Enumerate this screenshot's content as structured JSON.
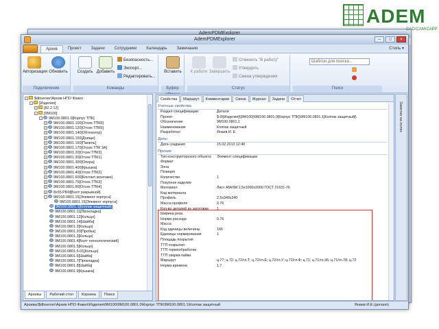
{
  "logo": {
    "text": "ADEM",
    "sub": "CAD/CAM/CAPP"
  },
  "back_window": {
    "title": "AdemPDMExplorer"
  },
  "window": {
    "title": "AdemPDMExplorer"
  },
  "ribbon_tabs": [
    "Архив",
    "Проект",
    "Задачи",
    "Сотрудники",
    "Календарь",
    "Замечания"
  ],
  "style_label": "Стиль ▾",
  "ribbon": {
    "groups": {
      "connect": "Подключение",
      "commands": "Команды",
      "clipboard": "Буфер обмена",
      "status": "Статус",
      "search": "Поиск"
    },
    "buttons": {
      "authorize": "Авторизация",
      "refresh": "Обновить",
      "create": "Создать",
      "add": "Добавить",
      "security": "Безопасность...",
      "export": "Экспорт...",
      "edit": "Редактировать...",
      "paste": "Вставить",
      "to_work": "К работе",
      "finish": "Завершить",
      "cancel_work": "Отменить \"В работу\"",
      "approve": "Утвердить",
      "change_approval": "Смена утверждения"
    },
    "search_placeholder": "Шаблон для поиска..."
  },
  "tree": [
    {
      "lvl": 0,
      "exp": "-",
      "icon": "folder",
      "text": "$dbserver\\Архив НПО Факел"
    },
    {
      "lvl": 1,
      "exp": "-",
      "icon": "folder",
      "text": "[Изделия]"
    },
    {
      "lvl": 2,
      "exp": "+",
      "icon": "folder",
      "text": "[82.2.12]"
    },
    {
      "lvl": 2,
      "exp": "-",
      "icon": "folder",
      "text": "[9M100]"
    },
    {
      "lvl": 3,
      "exp": "-",
      "icon": "gear",
      "text": "9M100.0801.0[Корпус ТПК]"
    },
    {
      "lvl": 4,
      "exp": "+",
      "icon": "gear",
      "text": "9M100.0801.100[Отсек ТПК5]"
    },
    {
      "lvl": 4,
      "exp": "+",
      "icon": "gear",
      "text": "9M100.0801.120[Отсек ТПК5]"
    },
    {
      "lvl": 4,
      "exp": "+",
      "icon": "gear",
      "text": "9M100.0801.140[Обтекатор]"
    },
    {
      "lvl": 4,
      "exp": "+",
      "icon": "gear",
      "text": "9M100.0801.150[Днище]"
    },
    {
      "lvl": 4,
      "exp": "+",
      "icon": "gear",
      "text": "9M100.0801.160[Панель]"
    },
    {
      "lvl": 4,
      "exp": "+",
      "icon": "gear",
      "text": "9M100.0801.170[Отсек ТПК 3А]"
    },
    {
      "lvl": 4,
      "exp": "+",
      "icon": "gear",
      "text": "9M100.0801.20[Отсек ТПК3]"
    },
    {
      "lvl": 4,
      "exp": "+",
      "icon": "gear",
      "text": "9M100.0801.30[Отсек ТПК1]"
    },
    {
      "lvl": 4,
      "exp": "+",
      "icon": "gear",
      "text": "9M100.0801.300[Опора]"
    },
    {
      "lvl": 4,
      "exp": "+",
      "icon": "gear",
      "text": "9M100.0801.400[Крышка]"
    },
    {
      "lvl": 4,
      "exp": "+",
      "icon": "gear",
      "text": "9M100.0801.40[Отсек ТПК2]"
    },
    {
      "lvl": 4,
      "exp": "+",
      "icon": "gear",
      "text": "9M100.0801.600[Контакт монтажн]"
    },
    {
      "lvl": 4,
      "exp": "+",
      "icon": "gear",
      "text": "9M100.0801.70[Отсек ТПК3]"
    },
    {
      "lvl": 4,
      "exp": "+",
      "icon": "gear",
      "text": "9M100.0801.80[Отсек ТПК4]"
    },
    {
      "lvl": 4,
      "exp": "+",
      "icon": "gear",
      "text": "8x55 РБМ[Болт разрывной]"
    },
    {
      "lvl": 4,
      "exp": "-",
      "icon": "gear",
      "text": "9M100.0801.15[Элемент корпуса]"
    },
    {
      "lvl": 5,
      "exp": "",
      "icon": "gear",
      "text": "9M100.0801.15[Элемент корпуса]"
    },
    {
      "lvl": 4,
      "exp": "",
      "icon": "gear",
      "text": "9M100.0801.1[Колпак защитный]",
      "sel": true
    },
    {
      "lvl": 4,
      "exp": "",
      "icon": "gear",
      "text": "9M100.0801.11[Прокладка]"
    },
    {
      "lvl": 4,
      "exp": "",
      "icon": "gear",
      "text": "9M100.0801.12[Кольцо]"
    },
    {
      "lvl": 4,
      "exp": "",
      "icon": "gear",
      "text": "9M100.0801.14[Шайба]"
    },
    {
      "lvl": 4,
      "exp": "",
      "icon": "gear",
      "text": "9M100.0801.2[Кольцо]"
    },
    {
      "lvl": 4,
      "exp": "",
      "icon": "gear",
      "text": "9M100.0801.20[Пробка]"
    },
    {
      "lvl": 4,
      "exp": "",
      "icon": "gear",
      "text": "9M100.0801.3[Кольцо]"
    },
    {
      "lvl": 4,
      "exp": "",
      "icon": "gear",
      "text": "9M100.0801.4[Болт технологический]"
    },
    {
      "lvl": 4,
      "exp": "",
      "icon": "gear",
      "text": "9M100.0801.5[Кольцо]"
    },
    {
      "lvl": 4,
      "exp": "",
      "icon": "gear",
      "text": "9M100.0801.5-01[Кольцо]"
    },
    {
      "lvl": 4,
      "exp": "",
      "icon": "gear",
      "text": "9M100.0801.6[Шайба]"
    },
    {
      "lvl": 4,
      "exp": "",
      "icon": "gear",
      "text": "9M100.0801.7[Прокладка]"
    },
    {
      "lvl": 4,
      "exp": "",
      "icon": "gear",
      "text": "9M100.0801.8[Шайба]"
    },
    {
      "lvl": 4,
      "exp": "",
      "icon": "gear",
      "text": "9M100.0801.9[Крышка]"
    }
  ],
  "left_tabs": [
    "Архивы",
    "Рабочий стол",
    "Корзина",
    "Поиск"
  ],
  "prop_tabs": [
    "Свойства",
    "Маршрут",
    "Комментарии",
    "Связи",
    "Журнал",
    "Задачи",
    "Отчет"
  ],
  "properties": [
    {
      "type": "sec",
      "text": "Учетные свойства"
    },
    {
      "type": "row",
      "k": "Раздел спецификации",
      "v": "Детали"
    },
    {
      "type": "row",
      "k": "Проект",
      "v": "$-9\\[Изделия]\\[9M100]\\9M100.0801.0[Корпус ТПК]\\9M100.0801.1[Колпак защитный]\\"
    },
    {
      "type": "row",
      "k": "Обозначение",
      "v": "9M100.0801.1"
    },
    {
      "type": "row",
      "k": "Наименование",
      "v": "Колпак защитный"
    },
    {
      "type": "row",
      "k": "Разработал",
      "v": "Янаев И. Е."
    },
    {
      "type": "sec",
      "text": "Даты"
    },
    {
      "type": "row",
      "k": "Дата создания",
      "v": "15.02.2013 12:40"
    },
    {
      "type": "sec",
      "text": "Прочие"
    },
    {
      "type": "row",
      "k": "Тип конструкторского объекта",
      "v": "Элемент спецификации"
    },
    {
      "type": "row",
      "k": "Формат",
      "v": ""
    },
    {
      "type": "row",
      "k": "Зона",
      "v": ""
    },
    {
      "type": "row",
      "k": "Позиция",
      "v": ""
    },
    {
      "type": "row",
      "k": "Количество",
      "v": "1"
    },
    {
      "type": "row",
      "k": "Покупное изделие",
      "v": ""
    },
    {
      "type": "row",
      "k": "Материал",
      "v": "Лист АМг6М 2,5х1000х2000 ГОСТ 21631-76"
    },
    {
      "type": "row",
      "k": "Код материала",
      "v": ""
    },
    {
      "type": "row",
      "k": "Профиль",
      "v": "2,5х340х340"
    },
    {
      "type": "row",
      "k": "Масса профиля",
      "v": "0.76"
    },
    {
      "type": "row",
      "k": "Кол-во деталей из заготовки",
      "v": "1"
    },
    {
      "type": "row",
      "k": "Ширина реза",
      "v": ""
    },
    {
      "type": "row",
      "k": "Норма расхода",
      "v": "0.76"
    },
    {
      "type": "row",
      "k": "Масса",
      "v": ""
    },
    {
      "type": "row",
      "k": "Код единицы величины",
      "v": "166"
    },
    {
      "type": "row",
      "k": "Единицы нормирования",
      "v": "1"
    },
    {
      "type": "row",
      "k": "Площадь покрытия",
      "v": ""
    },
    {
      "type": "row",
      "k": "ТТП покрытия",
      "v": ""
    },
    {
      "type": "row",
      "k": "ТТП термообработки",
      "v": ""
    },
    {
      "type": "row",
      "k": "ТТП сварки-пайки",
      "v": ""
    },
    {
      "type": "row",
      "k": "Маршрут",
      "v": "ц.77; ц.72; ц.72/гл.Т; ц.72/гл.Е; ц.72/гл.У; ц.72/гл.Ф; ц.71; ц.71/гл.36; ц.71/гл.78; ц.72"
    },
    {
      "type": "row",
      "k": "Норма времени",
      "v": "1,7"
    }
  ],
  "side_panel_label": "Заметки на полях",
  "statusbar": {
    "path": "Архивы\\$dbserver\\Архив НПО Факел\\Изделия\\9M100\\9M100.0801.0\\Корпус ТПК\\9M100.0801.1\\Колпак защитный",
    "user": "Янаев И.Е.(gorsam)"
  },
  "colors": {
    "highlight_box": "#e0332e",
    "selection": "#3b74c7",
    "brand_green": "#2e7d32"
  }
}
